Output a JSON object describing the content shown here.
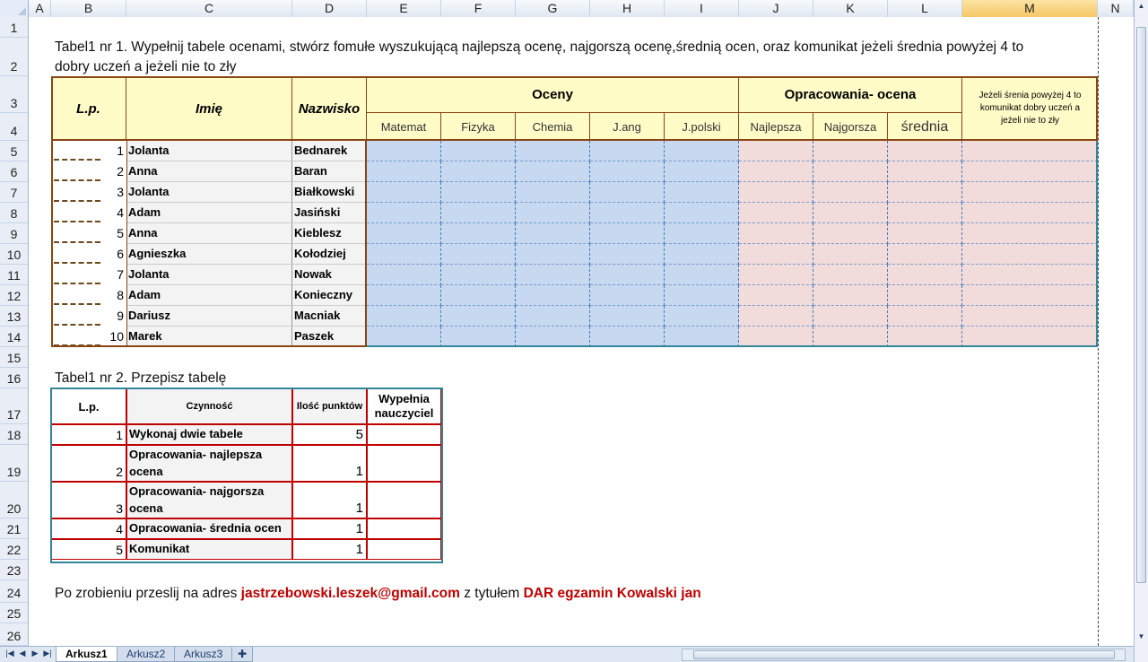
{
  "columns": [
    "A",
    "B",
    "C",
    "D",
    "E",
    "F",
    "G",
    "H",
    "I",
    "J",
    "K",
    "L",
    "M",
    "N"
  ],
  "selected_column": "M",
  "rows": [
    "1",
    "2",
    "3",
    "4",
    "5",
    "6",
    "7",
    "8",
    "9",
    "10",
    "11",
    "12",
    "13",
    "14",
    "15",
    "16",
    "17",
    "18",
    "19",
    "20",
    "21",
    "22",
    "23",
    "24",
    "25",
    "26"
  ],
  "task1": {
    "instruction_line1": "Tabel1 nr 1. Wypełnij tabele ocenami, stwórz fomułe wyszukującą najlepszą ocenę, najgorszą ocenę,średnią ocen, oraz komunikat jeżeli średnia powyżej 4 to",
    "instruction_line2": "dobry uczeń a jeżeli nie to zły",
    "headers": {
      "lp": "L.p.",
      "imie": "Imię",
      "nazwisko": "Nazwisko",
      "oceny": "Oceny",
      "opracowania": "Opracowania- ocena",
      "komunikat": "Jeżeli śrenia powyżej 4 to komunikat dobry uczeń a jeżeli nie to zły",
      "subjects": [
        "Matemat",
        "Fizyka",
        "Chemia",
        "J.ang",
        "J.polski"
      ],
      "stats": [
        "Najlepsza",
        "Najgorsza",
        "średnia"
      ]
    },
    "students": [
      {
        "lp": "1",
        "imie": "Jolanta",
        "nazwisko": "Bednarek"
      },
      {
        "lp": "2",
        "imie": "Anna",
        "nazwisko": "Baran"
      },
      {
        "lp": "3",
        "imie": "Jolanta",
        "nazwisko": "Białkowski"
      },
      {
        "lp": "4",
        "imie": "Adam",
        "nazwisko": "Jasiński"
      },
      {
        "lp": "5",
        "imie": "Anna",
        "nazwisko": "Kieblesz"
      },
      {
        "lp": "6",
        "imie": "Agnieszka",
        "nazwisko": "Kołodziej"
      },
      {
        "lp": "7",
        "imie": "Jolanta",
        "nazwisko": "Nowak"
      },
      {
        "lp": "8",
        "imie": "Adam",
        "nazwisko": "Konieczny"
      },
      {
        "lp": "9",
        "imie": "Dariusz",
        "nazwisko": "Macniak"
      },
      {
        "lp": "10",
        "imie": "Marek",
        "nazwisko": "Paszek"
      }
    ]
  },
  "task2": {
    "title": "Tabel1 nr 2. Przepisz tabelę",
    "headers": {
      "lp": "L.p.",
      "czynnosc": "Czynność",
      "punkty": "Ilość punktów",
      "nauczyciel": "Wypełnia nauczyciel"
    },
    "rows": [
      {
        "lp": "1",
        "line1": "Wykonaj dwie tabele",
        "line2": "",
        "punkty": "5"
      },
      {
        "lp": "2",
        "line1": "Opracowania- najlepsza",
        "line2": "ocena",
        "punkty": "1"
      },
      {
        "lp": "3",
        "line1": "Opracowania- najgorsza",
        "line2": "ocena",
        "punkty": "1"
      },
      {
        "lp": "4",
        "line1": "Opracowania- średnia ocen",
        "line2": "",
        "punkty": "1"
      },
      {
        "lp": "5",
        "line1": "Komunikat",
        "line2": "",
        "punkty": "1"
      }
    ]
  },
  "footer": {
    "prefix": "Po zrobieniu przeslij na adres ",
    "email": "jastrzebowski.leszek@gmail.com",
    "middle": " z tytułem ",
    "subject": "DAR egzamin Kowalski jan"
  },
  "sheet_tabs": [
    "Arkusz1",
    "Arkusz2",
    "Arkusz3"
  ],
  "active_tab": "Arkusz1"
}
